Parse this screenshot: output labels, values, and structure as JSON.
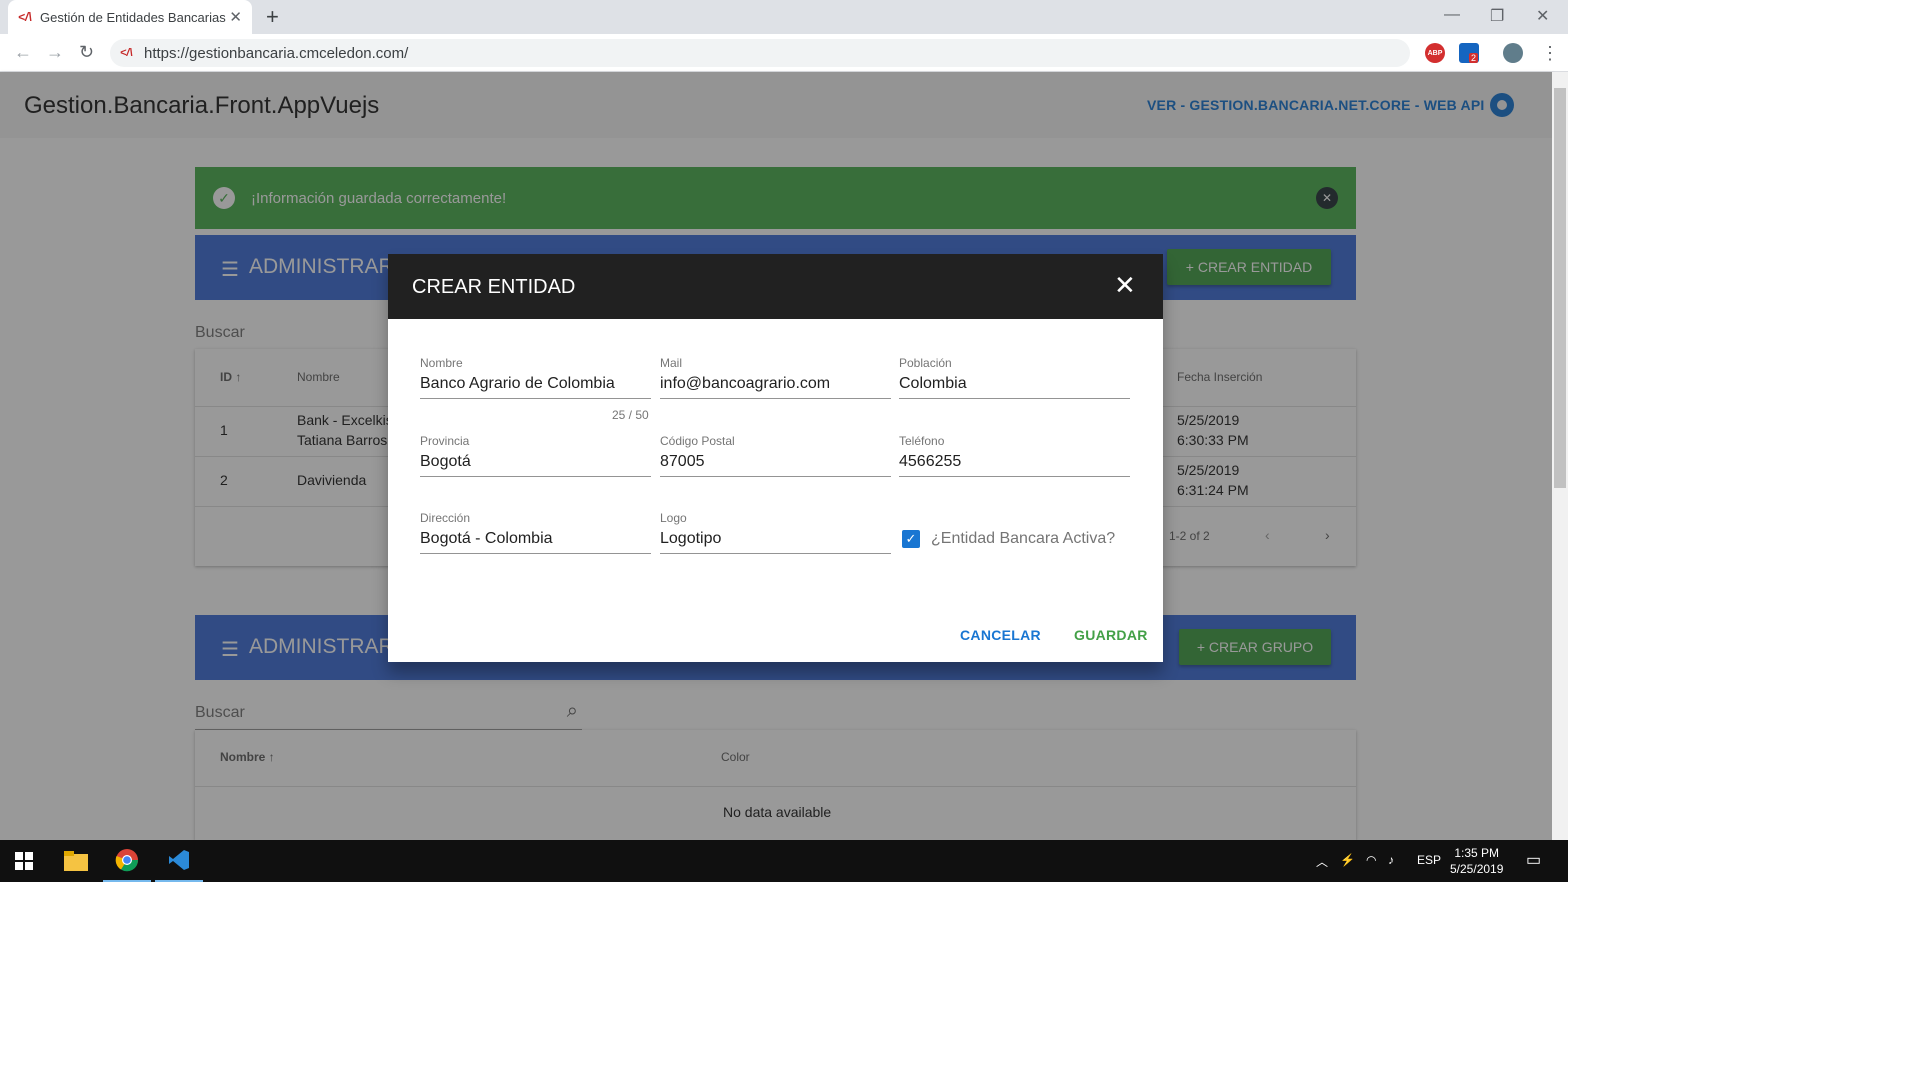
{
  "browser": {
    "tab_title": "Gestión de Entidades Bancarias",
    "url": "https://gestionbancaria.cmceledon.com/",
    "ext_abp": "ABP",
    "ext_badge": "2"
  },
  "app": {
    "brand": "Gestion.Bancaria.Front.AppVuejs",
    "api_link": "VER - GESTION.BANCARIA.NET.CORE - WEB API"
  },
  "alert": {
    "message": "¡Información guardada correctamente!"
  },
  "entities_section": {
    "title": "ADMINISTRAR",
    "create_button": "+ CREAR ENTIDAD",
    "search_label": "Buscar",
    "headers": {
      "id": "ID",
      "nombre": "Nombre",
      "fecha": "Fecha Inserción"
    },
    "rows": [
      {
        "id": "1",
        "nombre_1": "Bank - Excelkis",
        "nombre_2": "Tatiana Barros",
        "fecha_1": "5/25/2019",
        "fecha_2": "6:30:33 PM"
      },
      {
        "id": "2",
        "nombre_1": "Davivienda",
        "fecha_1": "5/25/2019",
        "fecha_2": "6:31:24 PM"
      }
    ],
    "pagination": "1-2 of 2"
  },
  "groups_section": {
    "title": "ADMINISTRAR",
    "create_button": "+ CREAR GRUPO",
    "search_label": "Buscar",
    "headers": {
      "nombre": "Nombre",
      "color": "Color"
    },
    "empty": "No data available"
  },
  "dialog": {
    "title": "CREAR ENTIDAD",
    "fields": {
      "nombre": {
        "label": "Nombre",
        "value": "Banco Agrario de Colombia",
        "counter": "25 / 50"
      },
      "mail": {
        "label": "Mail",
        "value": "info@bancoagrario.com"
      },
      "poblacion": {
        "label": "Población",
        "value": "Colombia"
      },
      "provincia": {
        "label": "Provincia",
        "value": "Bogotá"
      },
      "codigo_postal": {
        "label": "Código Postal",
        "value": "87005"
      },
      "telefono": {
        "label": "Teléfono",
        "value": "4566255"
      },
      "direccion": {
        "label": "Dirección",
        "value": "Bogotá - Colombia"
      },
      "logo": {
        "label": "Logo",
        "value": "Logotipo"
      }
    },
    "active_checkbox": {
      "label": "¿Entidad Bancara Activa?",
      "checked": true
    },
    "cancel": "CANCELAR",
    "save": "GUARDAR"
  },
  "taskbar": {
    "language": "ESP",
    "time": "1:35 PM",
    "date": "5/25/2019"
  },
  "colors": {
    "primary_blue": "#1976d2",
    "section_blue": "#3f6fd8",
    "success_green": "#4caf50",
    "button_green": "#43a047",
    "dialog_header": "#212121"
  }
}
